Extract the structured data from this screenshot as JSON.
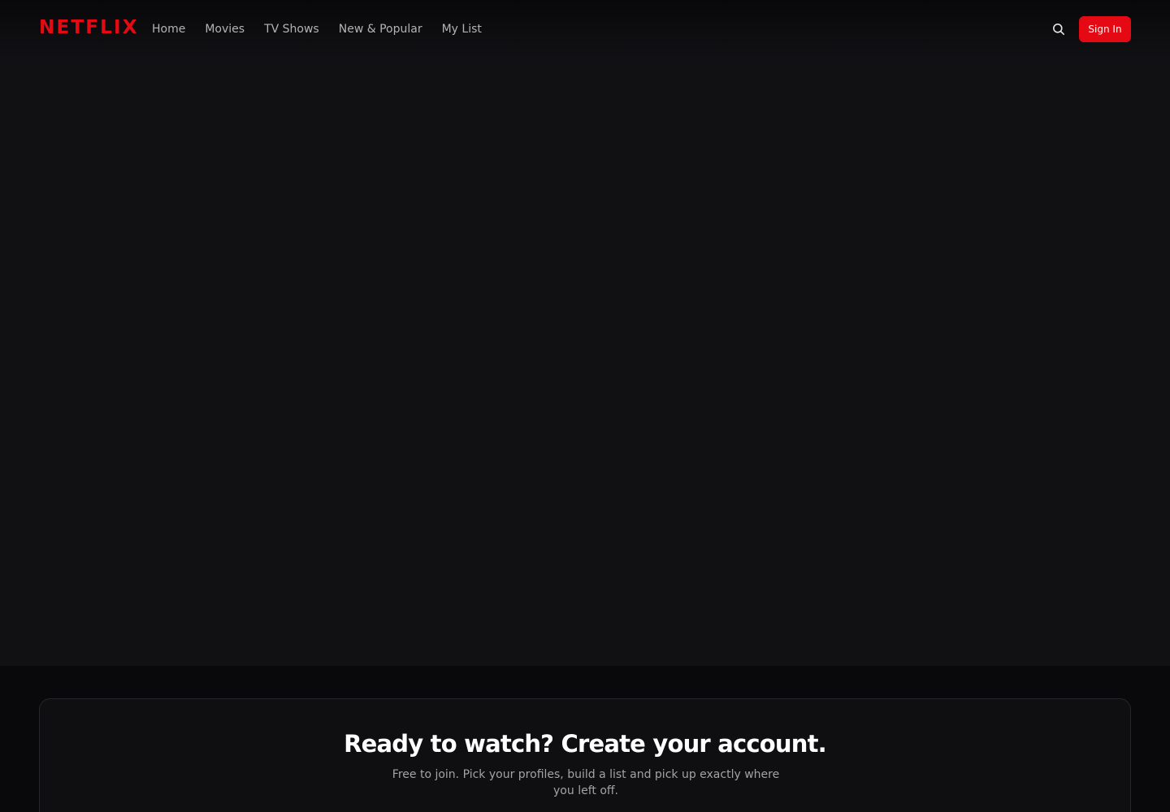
{
  "brand": {
    "logo_text": "NETFLIX",
    "accent_color": "#e50914"
  },
  "nav": {
    "links": [
      {
        "label": "Home"
      },
      {
        "label": "Movies"
      },
      {
        "label": "TV Shows"
      },
      {
        "label": "New & Popular"
      },
      {
        "label": "My List"
      }
    ],
    "search_icon": "search-icon",
    "signin_label": "Sign In"
  },
  "cta": {
    "title": "Ready to watch? Create your account.",
    "subtitle": "Free to join. Pick your profiles, build a list and pick up exactly where you left off."
  }
}
